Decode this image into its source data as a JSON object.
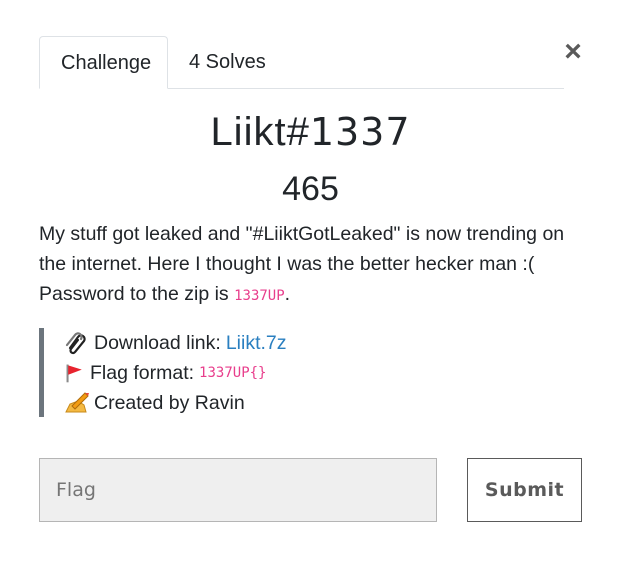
{
  "tabs": [
    {
      "label": "Challenge"
    },
    {
      "label": "4 Solves"
    }
  ],
  "close": {
    "glyph": "×"
  },
  "challenge": {
    "name_text": "Liikt#",
    "name_number": "1337",
    "value": "465",
    "description": {
      "line1": "My stuff got leaked and \"#LiiktGotLeaked\" is now trending on the internet. Here I thought I was the better hecker man :(",
      "password_prefix": "Password to the zip is ",
      "password": "1337UP",
      "password_suffix": "."
    },
    "info": {
      "download_label": "Download link:",
      "download_link": "Liikt.7z",
      "download_icon": "paperclips-icon",
      "flag_label": "Flag format:",
      "flag_format": "1337UP{}",
      "flag_icon": "triangular-flag-icon",
      "creator_label": "Created by Ravin",
      "creator_icon": "writing-hand-icon"
    }
  },
  "form": {
    "flag_placeholder": "Flag",
    "submit_label": "Submit"
  },
  "colors": {
    "link": "#2a7fc0",
    "code": "#e83e8c",
    "quote_border": "#6c757d",
    "input_bg": "#efefef"
  }
}
